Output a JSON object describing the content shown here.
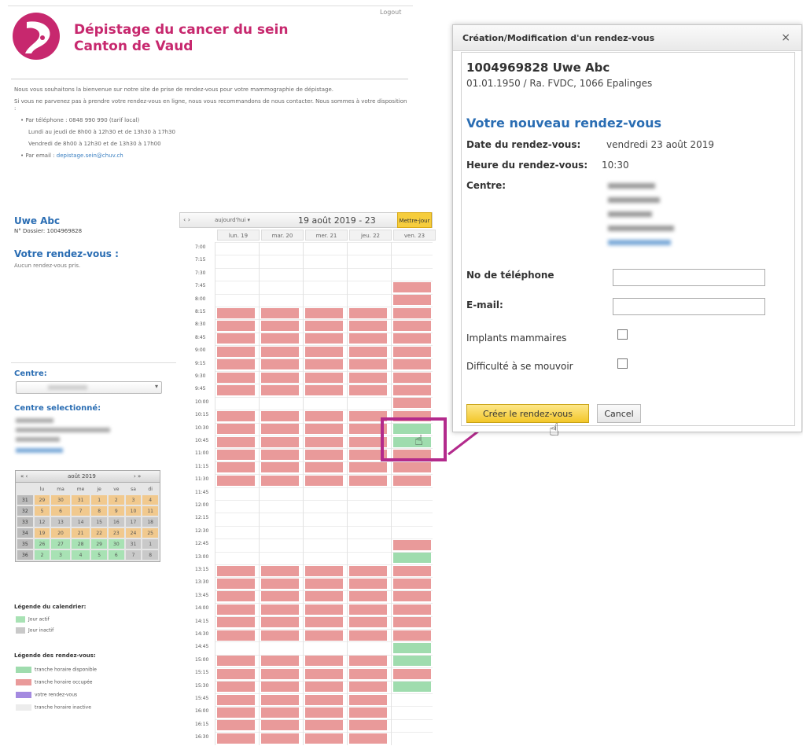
{
  "header": {
    "logout": "Logout",
    "brand_line1": "Dépistage du cancer du sein",
    "brand_line2": "Canton de Vaud"
  },
  "intro": {
    "welcome": "Nous vous souhaitons la bienvenue sur notre site de prise de rendez-vous pour votre mammographie de dépistage.",
    "contact": "Si vous ne parvenez pas à prendre votre rendez-vous en ligne, nous vous recommandons de nous contacter. Nous sommes à votre disposition :",
    "phone": "• Par téléphone : 0848 990 990 (tarif local)",
    "hours1": "Lundi au jeudi de 8h00 à 12h30 et de 13h30 à 17h30",
    "hours2": "Vendredi de 8h00 à 12h30 et de 13h30 à 17h00",
    "email_prefix": "• Par email : ",
    "email": "depistage.sein@chuv.ch"
  },
  "sidebar": {
    "patient_name": "Uwe Abc",
    "dossier": "N° Dossier: 1004969828",
    "rdv_title": "Votre rendez-vous :",
    "rdv_none": "Aucun rendez-vous pris.",
    "centre_label": "Centre:",
    "centre_selected_label": "Centre selectionné:",
    "minical": {
      "prev": "«  ‹",
      "month": "août 2019",
      "next": "›  »",
      "weekdays": [
        "lu",
        "ma",
        "me",
        "je",
        "ve",
        "sa",
        "di"
      ],
      "weeks": [
        {
          "wk": "31",
          "days": [
            "29",
            "30",
            "31",
            "1",
            "2",
            "3",
            "4"
          ]
        },
        {
          "wk": "32",
          "days": [
            "5",
            "6",
            "7",
            "8",
            "9",
            "10",
            "11"
          ]
        },
        {
          "wk": "33",
          "days": [
            "12",
            "13",
            "14",
            "15",
            "16",
            "17",
            "18"
          ]
        },
        {
          "wk": "34",
          "days": [
            "19",
            "20",
            "21",
            "22",
            "23",
            "24",
            "25"
          ]
        },
        {
          "wk": "35",
          "days": [
            "26",
            "27",
            "28",
            "29",
            "30",
            "31",
            "1"
          ]
        },
        {
          "wk": "36",
          "days": [
            "2",
            "3",
            "4",
            "5",
            "6",
            "7",
            "8"
          ]
        }
      ]
    },
    "legend_cal_title": "Légende du calendrier:",
    "legend_cal": [
      "Jour actif",
      "Jour inactif"
    ],
    "legend_rdv_title": "Légende des rendez-vous:",
    "legend_rdv": [
      "tranche horaire disponible",
      "tranche horaire occupée",
      "votre rendez-vous",
      "tranche horaire inactive"
    ]
  },
  "calendar": {
    "prevnext": "‹  ›",
    "today": "aujourd'hui  ▾",
    "range": "19 août 2019 - 23",
    "refresh": "Mettre-jour",
    "days": [
      "lun. 19",
      "mar. 20",
      "mer. 21",
      "jeu. 22",
      "ven. 23"
    ],
    "times": [
      "7:00",
      "7:15",
      "7:30",
      "7:45",
      "8:00",
      "8:15",
      "8:30",
      "8:45",
      "9:00",
      "9:15",
      "9:30",
      "9:45",
      "10:00",
      "10:15",
      "10:30",
      "10:45",
      "11:00",
      "11:15",
      "11:30",
      "11:45",
      "12:00",
      "12:15",
      "12:30",
      "12:45",
      "13:00",
      "13:15",
      "13:30",
      "13:45",
      "14:00",
      "14:15",
      "14:30",
      "14:45",
      "15:00",
      "15:15",
      "15:30",
      "15:45",
      "16:00",
      "16:15",
      "16:30"
    ],
    "friday_slots": [
      "inactive",
      "inactive",
      "inactive",
      "occupied",
      "occupied",
      "occupied",
      "occupied",
      "occupied",
      "occupied",
      "occupied",
      "occupied",
      "occupied",
      "occupied",
      "occupied",
      "available",
      "available",
      "occupied",
      "occupied",
      "occupied",
      "inactive",
      "inactive",
      "inactive",
      "inactive",
      "occupied",
      "available",
      "occupied",
      "occupied",
      "occupied",
      "occupied",
      "occupied",
      "occupied",
      "available",
      "available",
      "occupied",
      "available",
      "inactive",
      "inactive",
      "inactive",
      "inactive"
    ],
    "weekday_slots": [
      "inactive",
      "inactive",
      "inactive",
      "inactive",
      "inactive",
      "occupied",
      "occupied",
      "occupied",
      "occupied",
      "occupied",
      "occupied",
      "occupied",
      "inactive",
      "occupied",
      "occupied",
      "occupied",
      "occupied",
      "occupied",
      "occupied",
      "inactive",
      "inactive",
      "inactive",
      "inactive",
      "inactive",
      "inactive",
      "occupied",
      "occupied",
      "occupied",
      "occupied",
      "occupied",
      "occupied",
      "inactive",
      "occupied",
      "occupied",
      "occupied",
      "occupied",
      "occupied",
      "occupied",
      "occupied"
    ]
  },
  "dialog": {
    "title": "Création/Modification d'un rendez-vous",
    "close": "×",
    "patient": "1004969828 Uwe Abc",
    "patient_info": "01.01.1950 / Ra. FVDC, 1066 Epalinges",
    "new_rdv": "Votre nouveau rendez-vous",
    "date_label": "Date du rendez-vous:",
    "date_value": "vendredi 23 août 2019",
    "time_label": "Heure du rendez-vous:",
    "time_value": "10:30",
    "centre_label": "Centre:",
    "phone_label": "No de téléphone",
    "email_label": "E-mail:",
    "implants_label": "Implants mammaires",
    "mobility_label": "Difficulté à se mouvoir",
    "create_button": "Créer le rendez-vous",
    "cancel_button": "Cancel"
  },
  "colors": {
    "brand": "#c7286e",
    "title_blue": "#2a6db3",
    "occupied": "#e99a9a",
    "available": "#9fdcae",
    "highlight": "#b32a8c",
    "button_yellow": "#f3c72a"
  }
}
